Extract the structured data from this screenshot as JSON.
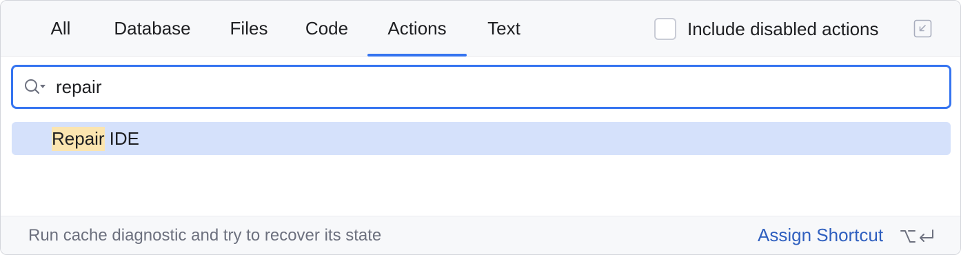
{
  "tabs": [
    {
      "label": "All"
    },
    {
      "label": "Database"
    },
    {
      "label": "Files"
    },
    {
      "label": "Code"
    },
    {
      "label": "Actions",
      "selected": true
    },
    {
      "label": "Text"
    }
  ],
  "include_disabled": {
    "label": "Include disabled actions",
    "checked": false
  },
  "search": {
    "value": "repair",
    "placeholder": ""
  },
  "results": [
    {
      "match": "Repair",
      "rest": "IDE",
      "selected": true
    }
  ],
  "footer": {
    "description": "Run cache diagnostic and try to recover its state",
    "assign_shortcut": "Assign Shortcut"
  },
  "colors": {
    "accent": "#3574f0",
    "selection": "#d5e1fb",
    "match_highlight": "#fbe5b0",
    "link": "#2f5fbf"
  },
  "icons": {
    "search": "search-with-dropdown-icon",
    "pin": "open-in-tool-window-icon",
    "shortcut": "option-enter-icon"
  }
}
